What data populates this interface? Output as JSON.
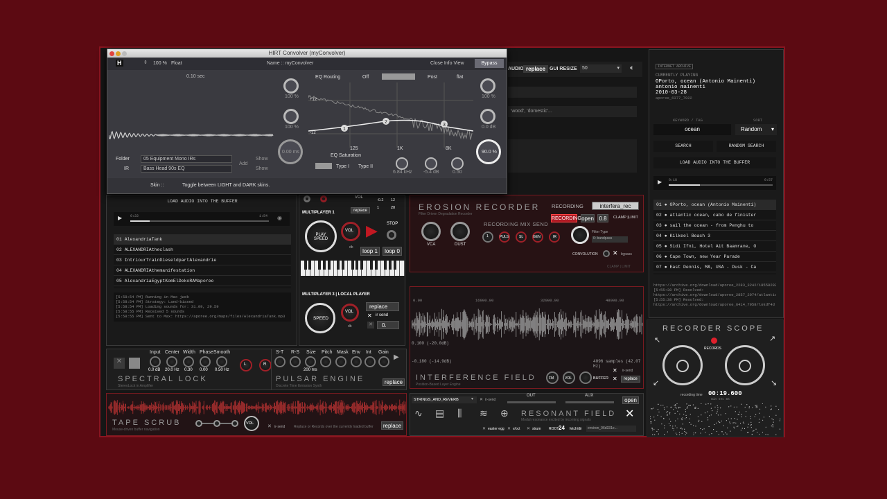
{
  "plugin": {
    "title": "HIRT Convolver (myConvolver)",
    "zoom": "100 %",
    "mode": "Float",
    "name_label": "Name :: myConvolver",
    "close_info": "Close Info View",
    "bypass": "Bypass",
    "time": "0.10 sec",
    "eq_routing": "EQ Routing",
    "eq_off": "Off",
    "eq_post": "Post",
    "eq_flat": "flat",
    "eq_plus": "+12",
    "eq_minus": "-12",
    "freq_125": "125",
    "freq_1k": "1K",
    "freq_8k": "8K",
    "folder_label": "Folder",
    "folder_value": "05 Equipment Mono IRs",
    "ir_label": "IR",
    "ir_value": "Bass Head 90s EQ",
    "add": "Add",
    "show1": "Show",
    "show2": "Show",
    "eq_saturation": "EQ Saturation",
    "type1": "Type I",
    "type2": "Type II",
    "skin_label": "Skin ::",
    "skin_hint": "Toggle between LIGHT and DARK skins.",
    "node1": "1",
    "node2": "2",
    "node3": "3",
    "k_val1": "100 %",
    "k_val2": "100 %",
    "k_val3": "0.00 ms",
    "k_val4": "100 %",
    "k_val5": "0.0 dB",
    "k_val6": "90.0 %",
    "f1": "6.84 kHz",
    "f2": "-5.4 dB",
    "f3": "0.50"
  },
  "top": {
    "audio": "AUDIO",
    "replace": "replace",
    "gui_resize": "GUI RESIZE",
    "gui_value": "50",
    "query": "'wood', 'domestic'..."
  },
  "archive": {
    "badge": "INTERNET ARCHIVE",
    "currently": "CURRENTLY PLAYING",
    "title": "OPorto, ocean (Antonio Mainenti)",
    "artist": "antonio mainenti",
    "date": "2010-03-28",
    "id": "aporee_6377_7922",
    "keyword_label": "KEYWORD / TAG",
    "sort_label": "SORT",
    "keyword": "ocean",
    "sort": "Random",
    "search": "SEARCH",
    "random_search": "RANDOM SEARCH",
    "load": "LOAD AUDIO INTO THE BUFFER",
    "t0": "0:18",
    "t1": "0:57",
    "list": [
      "01 ● OPorto, ocean (Antonio Mainenti)",
      "02 ● atlantic ocean, cabo de finister",
      "03 ● sail the ocean - from Penghu to",
      "04 ● Kilkeel Beach 3",
      "05 ● Sidi Ifni, Hotel Ait Baamrane, O",
      "06 ● Cape Town, new Year Parade",
      "07 ● East Dennis, MA, USA - Dusk - Ca"
    ],
    "console": "https://archive.org/download/aporee_2283_3242/18558282\n[5:55:38 PM] Resolved:\nhttps://archive.org/download/aporee_2857_2974/atlantic\n[5:55:38 PM] Resolved:\nhttps://archive.org/download/aporee_6414_7958/lokdf4d"
  },
  "left": {
    "load": "LOAD AUDIO INTO THE BUFFER",
    "t0": "0:22",
    "t1": "1:54",
    "list": [
      "01  AlexandriaTank",
      "02  ALEXANDRIAtheclash",
      "03  IntriourTrainDieseldpartAlexandrie",
      "04  ALEXANDRIAthemanifestation",
      "05  AlexandriaEgyptKomElDekoRAMaporee"
    ],
    "console": "[5:58:54 PM] Running in Max jweb\n[5:58:54 PM] Strategy: Land-biased\n[5:58:54 PM] Loading sounds for: 31.09, 29.59\n[5:58:55 PM] Received 5 sounds\n[5:58:55 PM] Sent to Max: https://aporee.org/maps/files/AlexandriaTank.mp3"
  },
  "mp": {
    "mp1": "MULTIPLAYER 1",
    "play_speed": "PLAY SPEED",
    "vol": "VOL",
    "db": "db",
    "send": "send",
    "replace": "replace",
    "stop": "STOP",
    "loop1": "loop 1",
    "loop0": "loop 0",
    "v1": "-0.2",
    "v2": "12",
    "v3": "1",
    "v4": "20",
    "mp3": "MULTIPLAYER 3 | LOCAL PLAYER",
    "speed": "SPEED",
    "replace2": "replace",
    "irsend": "ir send",
    "zero": "0."
  },
  "erosion": {
    "title": "EROSION RECORDER",
    "sub": "Filter Driven Degradation Recorder",
    "recording_label": "RECORDING",
    "file": "interfera_rec",
    "rec_btn": "RECORDING",
    "open": "open",
    "val": "0.8",
    "clamp": "CLAMP |LIMIT",
    "mix": "RECORDING MIX SEND",
    "vca": "VCA",
    "dust": "DUST",
    "k1": "1",
    "puls": "PULS",
    "sl": "SL",
    "gen": "GEN",
    "ir": "IR",
    "filter_type": "Filter Type",
    "bandpass": "0: bandpass",
    "convolution": "CONVOLUTION",
    "bypass": "bypass",
    "clamp2": "CLAMP | LIMIT"
  },
  "interference": {
    "t0": "0.00",
    "t1": "16000.00",
    "t2": "32000.00",
    "t3": "48000.00",
    "a": "0.100 (-20.0dB)",
    "b": "-0.180 (-14.9dB)",
    "samples": "4096 samples (42.07 Hz)",
    "title": "INTERFERENCE FIELD",
    "sub": "Position-Based Layer Engine",
    "fm": "FM",
    "vol": "VOL",
    "buffer": "BUFFER",
    "irsend": "ir-send",
    "replace": "replace"
  },
  "scope": {
    "title": "RECORDER SCOPE",
    "records": "RECORDS",
    "rec_time_label": "recording time",
    "time": "00:19.600",
    "units": "min   sec   ms"
  },
  "spectral": {
    "input": "Input",
    "center": "Center",
    "width": "Width",
    "phase": "Phase",
    "smooth": "Smooth",
    "v_in": "0.0 dB",
    "v_c": "20.0 Hz",
    "v_w": "0.30",
    "v_p": "0.00",
    "v_s": "0.50 Hz",
    "title": "SPECTRAL LOCK",
    "sub": "StereoLock in Amplifier",
    "l": "L",
    "r": "R"
  },
  "pulsar": {
    "st": "S-T",
    "rs": "R-S",
    "size": "Size",
    "pitch": "Pitch",
    "mask": "Mask",
    "env": "Env",
    "int": "Int",
    "gain": "Gain",
    "v_size": "200 ms",
    "title": "PULSAR ENGINE",
    "sub": "Discrete Time Emission Synth",
    "replace": "replace"
  },
  "tape": {
    "title": "TAPE SCRUB",
    "sub": "Mouse-driven buffer navigation",
    "vol": "VOL",
    "irsend": "ir-send",
    "hint": "Replace or Records over the currently loaded buffer",
    "replace": "replace"
  },
  "resonant": {
    "preset": "STRINGS_AND_REVERB",
    "irsend": "ir-send",
    "out": "OUT",
    "aux": "AUX",
    "open": "open",
    "title": "RESONANT FIELD",
    "sub": "Modal resonance excited by incoming signals",
    "easter": "easter egg",
    "vtrack": "v/oct",
    "strum": "strum",
    "root_lbl": "ROOT",
    "root": "24",
    "fetch": "fetch/dir",
    "env": "environ_06d331e..."
  }
}
